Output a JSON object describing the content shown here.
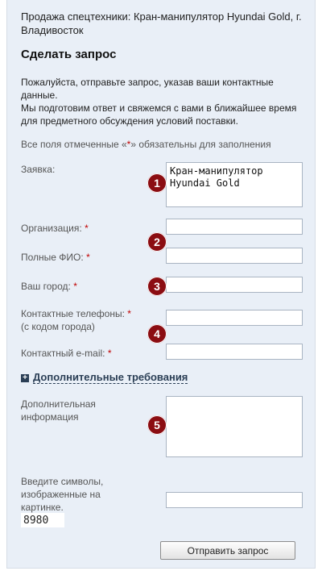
{
  "intro_title": "Продажа спецтехники: Кран-манипулятор Hyundai Gold, г. Владивосток",
  "heading": "Сделать запрос",
  "description_line1": "Пожалуйста, отправьте запрос, указав ваши контактные данные.",
  "description_line2": "Мы подготовим ответ и свяжемся с вами в ближайшее время для предметного обсуждения условий поставки.",
  "required_note_before": "Все поля отмеченные «",
  "required_mark": "*",
  "required_note_after": "» обязательны для заполнения",
  "form": {
    "request_label": "Заявка:",
    "request_value": "Кран-манипулятор Hyundai Gold",
    "organization_label": "Организация:",
    "fullname_label": "Полные ФИО:",
    "city_label": "Ваш город:",
    "phones_label_line1": "Контактные телефоны:",
    "phones_label_line2": "(с кодом города)",
    "email_label": "Контактный e-mail:",
    "additional_toggle": "Дополнительные требования",
    "additional_info_label_line1": "Дополнительная",
    "additional_info_label_line2": "информация",
    "captcha_label_line1": "Введите символы,",
    "captcha_label_line2": "изображенные на",
    "captcha_label_line3": "картинке.",
    "captcha_code": "8980",
    "submit_label": "Отправить запрос"
  },
  "markers": [
    "1",
    "2",
    "3",
    "4",
    "5"
  ],
  "colors": {
    "panel_background": "#e9eff7",
    "marker": "#8b0d12",
    "required": "#c00000"
  }
}
